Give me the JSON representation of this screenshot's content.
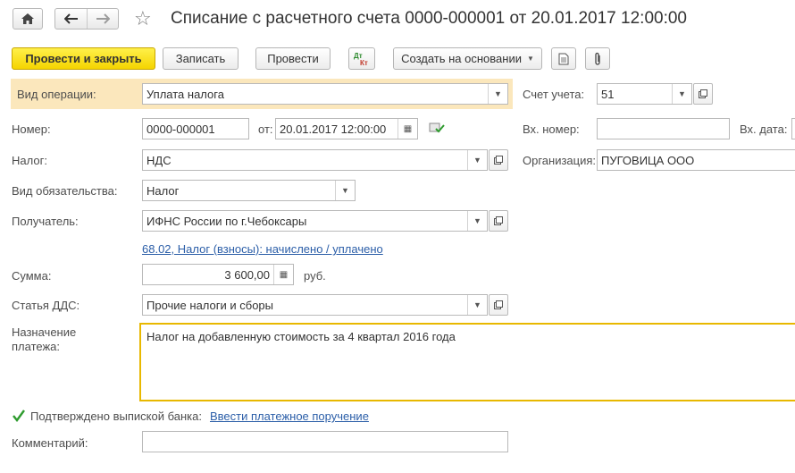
{
  "window": {
    "title": "Списание с расчетного счета 0000-000001 от 20.01.2017 12:00:00"
  },
  "toolbar": {
    "post_close": "Провести и закрыть",
    "save": "Записать",
    "post": "Провести",
    "dt_kt": "Дт Кт",
    "create_based": "Создать на основании"
  },
  "form": {
    "op_type_label": "Вид операции:",
    "op_type_value": "Уплата налога",
    "account_label": "Счет учета:",
    "account_value": "51",
    "number_label": "Номер:",
    "number_value": "0000-000001",
    "from_label": "от:",
    "date_value": "20.01.2017 12:00:00",
    "in_number_label": "Вх. номер:",
    "in_number_value": "",
    "in_date_label": "Вх. дата:",
    "tax_label": "Налог:",
    "tax_value": "НДС",
    "org_label": "Организация:",
    "org_value": "ПУГОВИЦА ООО",
    "obligation_label": "Вид обязательства:",
    "obligation_value": "Налог",
    "recipient_label": "Получатель:",
    "recipient_value": "ИФНС России по г.Чебоксары",
    "account_link": "68.02, Налог (взносы): начислено / уплачено",
    "sum_label": "Сумма:",
    "sum_value": "3 600,00",
    "currency": "руб.",
    "dds_label": "Статья ДДС:",
    "dds_value": "Прочие налоги и сборы",
    "purpose_label": "Назначение платежа:",
    "purpose_label_1": "Назначение",
    "purpose_label_2": "платежа:",
    "purpose_value": "Налог на добавленную стоимость за 4 квартал 2016 года",
    "confirmed_label": "Подтверждено выпиской банка:",
    "confirmed_checked": true,
    "order_link": "Ввести платежное поручение",
    "comment_label": "Комментарий:",
    "comment_value": ""
  },
  "colors": {
    "primary_button": "#f5d400",
    "highlight_row": "#fbe7bc",
    "active_border": "#e8b800",
    "link": "#2b5ea8"
  }
}
